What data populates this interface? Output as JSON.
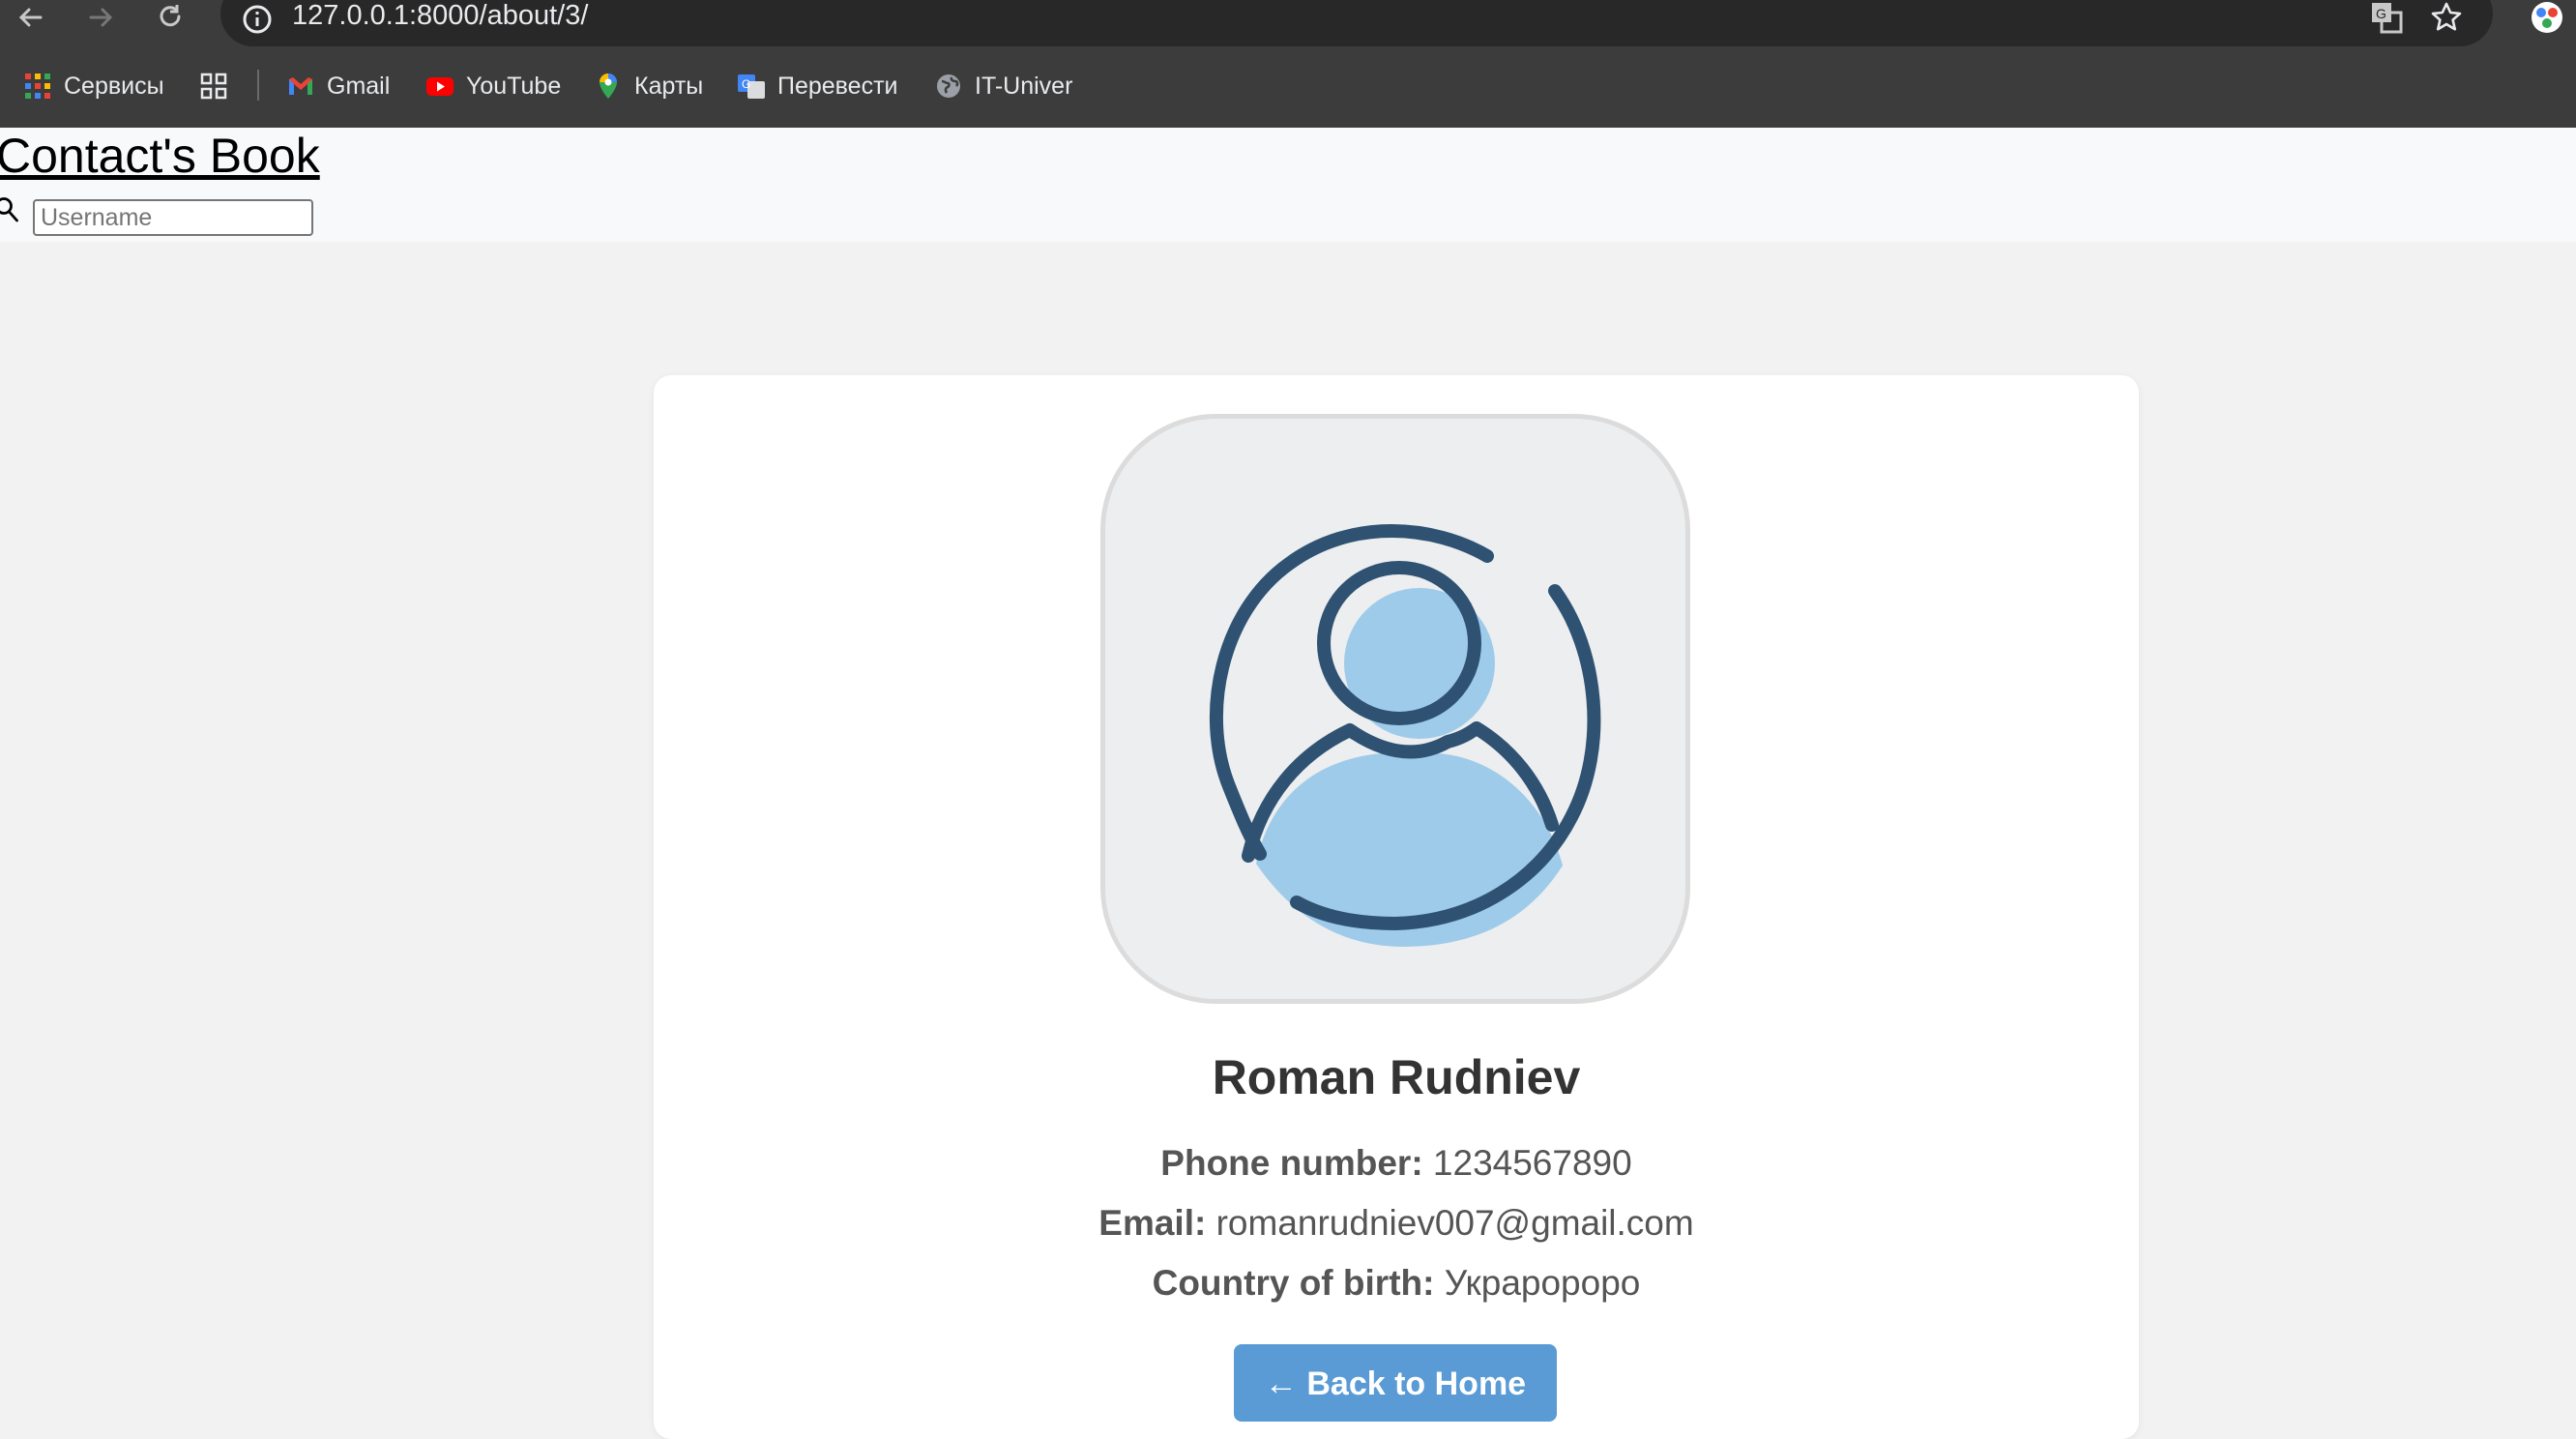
{
  "browser": {
    "url": "127.0.0.1:8000/about/3/",
    "bookmarks": [
      {
        "label": "Сервисы",
        "icon": "apps-grid-icon"
      },
      {
        "label": "",
        "icon": "tab-groups-icon"
      },
      {
        "label": "Gmail",
        "icon": "gmail-icon"
      },
      {
        "label": "YouTube",
        "icon": "youtube-icon"
      },
      {
        "label": "Карты",
        "icon": "maps-pin-icon"
      },
      {
        "label": "Перевести",
        "icon": "translate-icon"
      },
      {
        "label": "IT-Univer",
        "icon": "globe-icon"
      }
    ]
  },
  "header": {
    "title": "Contact's Book",
    "search_placeholder": "Username"
  },
  "contact": {
    "name": "Roman Rudniev",
    "phone_label": "Phone number:",
    "phone": "1234567890",
    "email_label": "Email:",
    "email": "romanrudniev007@gmail.com",
    "country_label": "Country of birth:",
    "country": "Украророро",
    "back_button": "← Back to Home"
  },
  "colors": {
    "accent": "#5a9bd5",
    "avatar_stroke": "#2f5273",
    "avatar_fill": "#9fcbea"
  }
}
